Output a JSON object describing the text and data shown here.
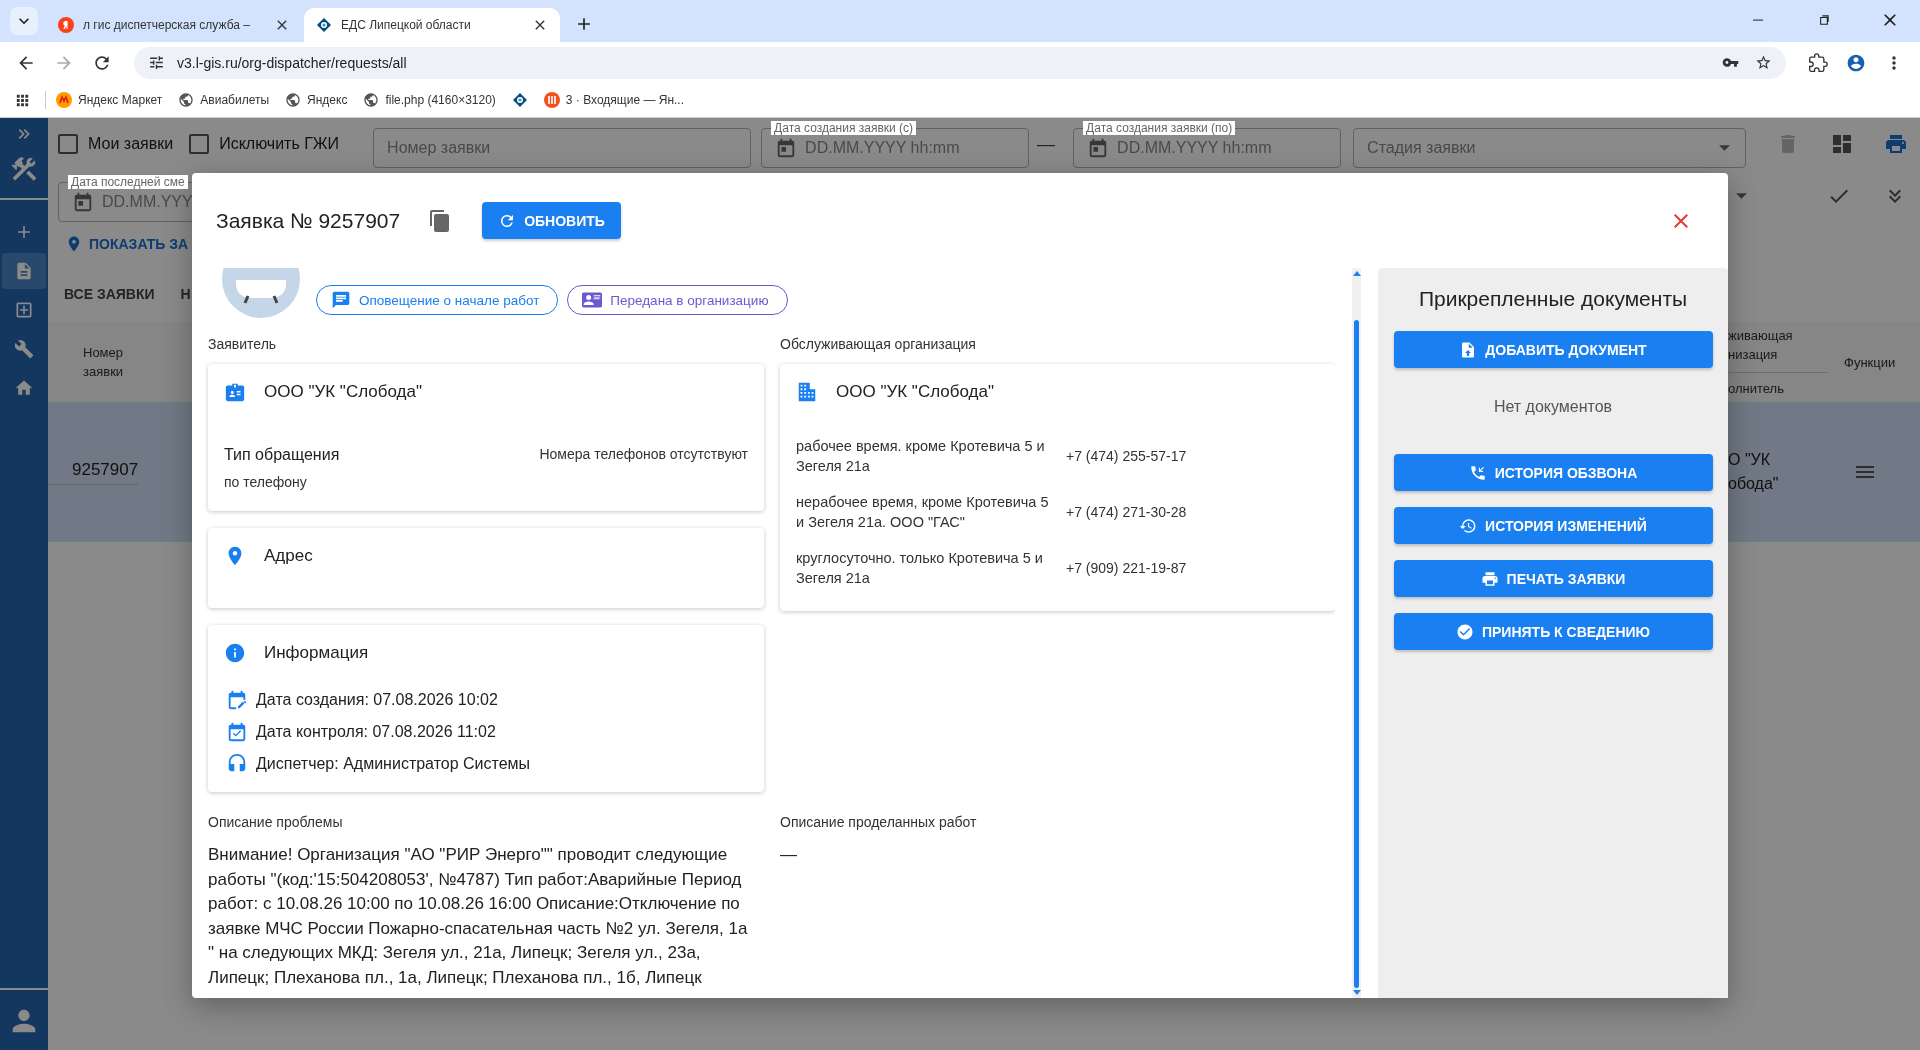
{
  "browser": {
    "tabs": [
      {
        "title": "л гис диспетчерская служба –",
        "kind": "yandex",
        "selected": false
      },
      {
        "title": "ЕДС Липецкой области",
        "kind": "eds",
        "selected": true
      }
    ],
    "url": "v3.l-gis.ru/org-dispatcher/requests/all",
    "bookmarks": [
      {
        "kind": "market",
        "label": "Яндекс Маркет"
      },
      {
        "kind": "globe",
        "label": "Авиабилеты"
      },
      {
        "kind": "globe",
        "label": "Яндекс"
      },
      {
        "kind": "globe",
        "label": "file.php (4160×3120)"
      },
      {
        "kind": "eds"
      },
      {
        "kind": "mail",
        "label": "3 · Входящие — Ян..."
      }
    ]
  },
  "sidebar": {
    "items": [
      {
        "kind": "add",
        "selected": false
      },
      {
        "kind": "document",
        "selected": true
      },
      {
        "kind": "plus-box",
        "selected": false
      },
      {
        "kind": "wrench",
        "selected": false
      },
      {
        "kind": "home",
        "selected": false
      }
    ]
  },
  "filters": {
    "checkboxes": [
      {
        "label": "Мои заявки",
        "checked": false
      },
      {
        "label": "Исключить ГЖИ",
        "checked": false
      }
    ],
    "number_field": {
      "placeholder": "Номер заявки"
    },
    "created_from": {
      "label": "Дата создания заявки (с)",
      "placeholder": "DD.MM.YYYY hh:mm"
    },
    "range_dash": "—",
    "created_to": {
      "label": "Дата создания заявки (по)",
      "placeholder": "DD.MM.YYYY hh:mm"
    },
    "stage": {
      "placeholder": "Стадия заявки"
    },
    "last_change": {
      "label": "Дата последней сме",
      "placeholder": "DD.MM.YYY"
    }
  },
  "show_link": "ПОКАЗАТЬ ЗА",
  "list_tabs": [
    {
      "label": "ВСЕ ЗАЯВКИ"
    },
    {
      "label": "Н"
    }
  ],
  "table": {
    "columns": [
      {
        "label": "Номер\nзаявки"
      },
      {
        "label": "живающая\nнизация"
      },
      {
        "label": "олнитель"
      },
      {
        "label": "Функции"
      }
    ],
    "rows": [
      {
        "number": "9257907",
        "org": "О \"УК\nобода\"",
        "selected": true
      }
    ]
  },
  "modal": {
    "title": "Заявка № 9257907",
    "refresh_button": "ОБНОВИТЬ",
    "chips": [
      {
        "kind": "notice",
        "label": "Оповещение о начале работ",
        "color": "#1a7ff0"
      },
      {
        "kind": "transfer",
        "label": "Передана в организацию",
        "color": "#6a5ad0"
      }
    ],
    "applicant": {
      "heading": "Заявитель",
      "name": "ООО \"УК \"Слобода\"",
      "contact_type_label": "Тип обращения",
      "contact_type": "по телефону",
      "phones": "Номера телефонов отсутствуют"
    },
    "address": {
      "heading": "Адрес"
    },
    "info": {
      "heading": "Информация",
      "items": [
        {
          "kind": "created",
          "text": "Дата создания: 07.08.2026 10:02"
        },
        {
          "kind": "control",
          "text": "Дата контроля: 07.08.2026 11:02"
        },
        {
          "kind": "dispatcher",
          "text": "Диспетчер: Администратор Системы"
        }
      ]
    },
    "org": {
      "heading": "Обслуживающая организация",
      "name": "ООО \"УК \"Слобода\"",
      "contacts": [
        {
          "note": "рабочее время. кроме Кротевича 5 и Зегеля 21а",
          "phone": "+7 (474) 255-57-17"
        },
        {
          "note": "нерабочее время, кроме Кротевича 5 и Зегеля 21а. ООО \"ГАС\"",
          "phone": "+7 (474) 271-30-28"
        },
        {
          "note": "круглосуточно. только Кротевича 5 и Зегеля 21а",
          "phone": "+7 (909) 221-19-87"
        }
      ]
    },
    "problem": {
      "heading": "Описание проблемы",
      "text": "Внимание! Организация \"АО \"РИР Энерго\"\" проводит следующие работы \"(код:'15:504208053', №4787) Тип работ:Аварийные Период работ: с 10.08.26 10:00 по 10.08.26 16:00 Описание:Отключение по заявке МЧС России Пожарно-спасательная часть №2 ул. Зегеля, 1а \" на следующих МКД: Зегеля ул., 21а, Липецк; Зегеля ул., 23а, Липецк; Плеханова пл., 1а, Липецк; Плеханова пл., 1б, Липецк"
    },
    "work": {
      "heading": "Описание проделанных работ",
      "text": "—"
    },
    "documents": {
      "title": "Прикрепленные документы",
      "add_button": "ДОБАВИТЬ ДОКУМЕНТ",
      "empty": "Нет документов",
      "buttons": [
        {
          "kind": "calls",
          "label": "ИСТОРИЯ ОБЗВОНА"
        },
        {
          "kind": "history",
          "label": "ИСТОРИЯ ИЗМЕНЕНИЙ"
        },
        {
          "kind": "print",
          "label": "ПЕЧАТЬ ЗАЯВКИ"
        },
        {
          "kind": "accept",
          "label": "ПРИНЯТЬ К СВЕДЕНИЮ"
        }
      ]
    }
  }
}
